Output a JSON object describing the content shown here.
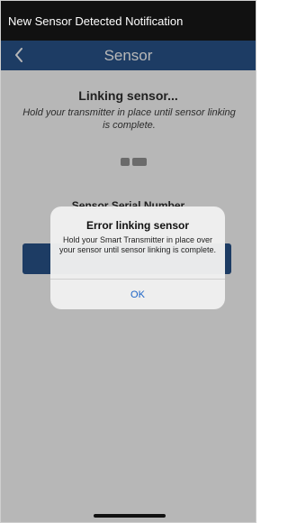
{
  "notification": {
    "text": "New Sensor Detected Notification"
  },
  "nav": {
    "title": "Sensor",
    "back_icon": "chevron-left-icon"
  },
  "main": {
    "heading": "Linking sensor...",
    "subtext": "Hold your transmitter in place until sensor linking is complete.",
    "serial_label": "Sensor Serial Number"
  },
  "alert": {
    "title": "Error linking sensor",
    "message": "Hold your Smart Transmitter in place over your sensor until sensor linking is complete.",
    "ok_label": "OK"
  },
  "colors": {
    "nav_bar": "#1d4a85",
    "notification_bar": "#111111",
    "alert_link": "#1a63c6",
    "overlay": "#b9b9b9"
  }
}
